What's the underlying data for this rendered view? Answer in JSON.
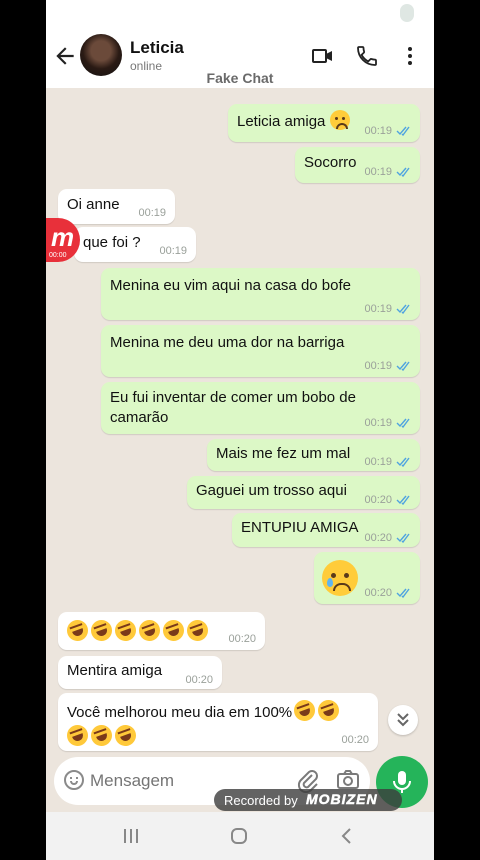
{
  "header": {
    "contact_name": "Leticia",
    "contact_status": "online",
    "watermark": "Fake Chat"
  },
  "messages": [
    {
      "dir": "out",
      "text": "Leticia amiga",
      "time": "00:19"
    },
    {
      "dir": "out",
      "text": "Socorro",
      "time": "00:19"
    },
    {
      "dir": "in",
      "text": "Oi anne",
      "time": "00:19"
    },
    {
      "dir": "in",
      "text": "que foi ?",
      "time": "00:19"
    },
    {
      "dir": "out",
      "text": "Menina eu vim aqui na casa do bofe",
      "time": "00:19"
    },
    {
      "dir": "out",
      "text": "Menina me deu uma dor na barriga",
      "time": "00:19"
    },
    {
      "dir": "out",
      "text_line1": "Eu fui inventar de comer um bobo de",
      "text_line2": "camarão",
      "time": "00:19"
    },
    {
      "dir": "out",
      "text": "Mais me fez um mal",
      "time": "00:19"
    },
    {
      "dir": "out",
      "text": "Gaguei um trosso aqui",
      "time": "00:20"
    },
    {
      "dir": "out",
      "text": "ENTUPIU AMIGA",
      "time": "00:20"
    },
    {
      "dir": "out",
      "emoji": "crying-face",
      "time": "00:20"
    },
    {
      "dir": "in",
      "emoji": "rolling-on-floor-laughing x6",
      "time": "00:20"
    },
    {
      "dir": "in",
      "text": "Mentira amiga",
      "time": "00:20"
    },
    {
      "dir": "in",
      "text": "Você melhorou meu dia em 100%",
      "time": "00:20"
    }
  ],
  "input": {
    "placeholder": "Mensagem"
  },
  "overlays": {
    "recorded_label": "Recorded by",
    "recorder_brand": "MOBIZEN",
    "badge_letter": "m",
    "badge_time": "00:00"
  },
  "colors": {
    "outgoing_bubble": "#dcf8c6",
    "incoming_bubble": "#ffffff",
    "chat_background": "#ece5dd",
    "accent_green": "#25b45a",
    "read_tick": "#4fa3e0"
  },
  "icons": [
    "back-arrow-icon",
    "video-call-icon",
    "phone-call-icon",
    "more-vertical-icon",
    "emoji-icon",
    "attach-icon",
    "camera-icon",
    "mic-icon",
    "double-chevron-down-icon"
  ]
}
